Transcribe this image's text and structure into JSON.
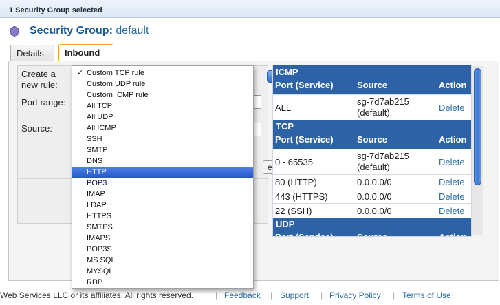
{
  "selection_bar": {
    "text": "1 Security Group selected"
  },
  "header": {
    "prefix": "Security Group:",
    "name": "default"
  },
  "tabs": [
    {
      "label": "Details"
    },
    {
      "label": "Inbound"
    }
  ],
  "form": {
    "create_label_1": "Create a",
    "create_label_2": "new rule:",
    "port_range_label": "Port range:",
    "source_label": "Source:",
    "add_button_label": "e"
  },
  "dropdown": {
    "selected_check": "✓",
    "options": [
      "Custom TCP rule",
      "Custom UDP rule",
      "Custom ICMP rule",
      "All TCP",
      "All UDP",
      "All ICMP",
      "SSH",
      "SMTP",
      "DNS",
      "HTTP",
      "POP3",
      "IMAP",
      "LDAP",
      "HTTPS",
      "SMTPS",
      "IMAPS",
      "POP3S",
      "MS SQL",
      "MYSQL",
      "RDP"
    ],
    "highlighted_index": 9
  },
  "rules": {
    "columns": {
      "port": "Port (Service)",
      "source": "Source",
      "action": "Action"
    },
    "sections": [
      {
        "title": "ICMP",
        "rows": [
          {
            "port": "ALL",
            "source1": "sg-7d7ab215",
            "source2": "(default)",
            "action": "Delete"
          }
        ]
      },
      {
        "title": "TCP",
        "rows": [
          {
            "port": "0 - 65535",
            "source1": "sg-7d7ab215",
            "source2": "(default)",
            "action": "Delete"
          },
          {
            "port": "80 (HTTP)",
            "source1": "0.0.0.0/0",
            "source2": "",
            "action": "Delete"
          },
          {
            "port": "443 (HTTPS)",
            "source1": "0.0.0.0/0",
            "source2": "",
            "action": "Delete"
          },
          {
            "port": "22 (SSH)",
            "source1": "0.0.0.0/0",
            "source2": "",
            "action": "Delete"
          }
        ]
      },
      {
        "title": "UDP",
        "rows": []
      }
    ]
  },
  "footer": {
    "copyright": "Web Services LLC or its affiliates. All rights reserved.",
    "links": [
      "Feedback",
      "Support",
      "Privacy Policy",
      "Terms of Use"
    ]
  },
  "colors": {
    "accent": "#2d63a6",
    "highlight": "#2658c9",
    "tab_active_border": "#f0a030"
  }
}
